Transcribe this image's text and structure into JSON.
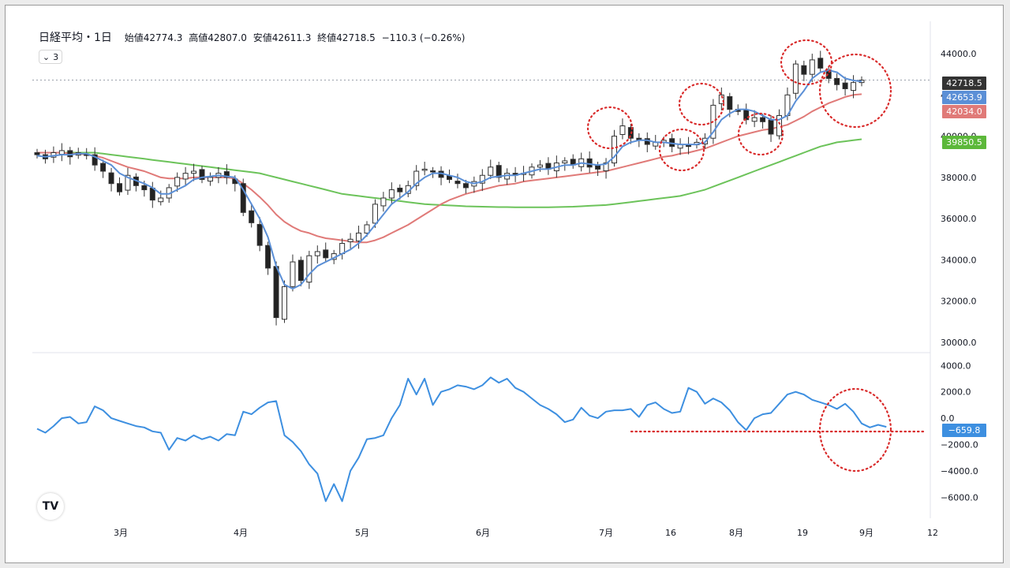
{
  "header": {
    "symbol": "日経平均・1日",
    "open_label": "始値",
    "open": "42774.3",
    "high_label": "高値",
    "high": "42807.0",
    "low_label": "安値",
    "low": "42611.3",
    "close_label": "終値",
    "close": "42718.5",
    "change": "−110.3 (−0.26%)"
  },
  "indicator_button": {
    "label": "3"
  },
  "logo_text": "TV",
  "colors": {
    "ma_short": "#5b8fd6",
    "ma_mid": "#e07a78",
    "ma_long": "#6cc35a",
    "oscillator": "#3d8fe0",
    "up_candle": "#ffffff",
    "down_candle": "#222222",
    "annotation": "#d92b2b"
  },
  "price_badges": [
    {
      "value": "42718.5",
      "color": "#333333"
    },
    {
      "value": "42653.9",
      "color": "#5b8fd6"
    },
    {
      "value": "42034.0",
      "color": "#e07a78"
    },
    {
      "value": "39850.5",
      "color": "#5cb83a"
    }
  ],
  "osc_badge": {
    "value": "−659.8",
    "color": "#3d8fe0"
  },
  "chart_data": {
    "type": "candlestick",
    "main_ylim": [
      29500,
      44500
    ],
    "main_yticks": [
      "44000.0",
      "42000.0",
      "40000.0",
      "38000.0",
      "36000.0",
      "34000.0",
      "32000.0",
      "30000.0"
    ],
    "osc_ylim": [
      -7000,
      4500
    ],
    "osc_yticks": [
      "4000.0",
      "2000.0",
      "0.0",
      "−2000.0",
      "−4000.0",
      "−6000.0"
    ],
    "x_labels": [
      "3月",
      "4月",
      "5月",
      "6月",
      "7月",
      "16",
      "8月",
      "19",
      "9月",
      "12"
    ],
    "close_values": [
      39100,
      38900,
      39200,
      39300,
      39000,
      39200,
      39100,
      38600,
      38300,
      37700,
      37300,
      38100,
      37600,
      37400,
      36900,
      37000,
      37500,
      38000,
      38200,
      38300,
      37900,
      38000,
      38200,
      38000,
      37700,
      36300,
      35800,
      34700,
      33600,
      31200,
      32700,
      33900,
      33000,
      34200,
      34400,
      34100,
      34300,
      34800,
      35000,
      35300,
      35700,
      36700,
      37000,
      37400,
      37300,
      37600,
      38300,
      38400,
      38300,
      38000,
      37900,
      37700,
      37500,
      37800,
      38100,
      38500,
      38000,
      38200,
      38100,
      38200,
      38500,
      38600,
      38400,
      38700,
      38800,
      38600,
      38900,
      38500,
      38400,
      38700,
      40000,
      40500,
      39900,
      39800,
      39600,
      39700,
      39800,
      39500,
      39600,
      39500,
      39700,
      39900,
      41500,
      42000,
      41300,
      41200,
      40800,
      40900,
      40700,
      40100,
      41000,
      42000,
      43500,
      43000,
      43700,
      43300,
      42800,
      42500,
      42300,
      42600,
      42718.5
    ],
    "ma_short_values": [
      39050,
      39000,
      39050,
      39100,
      39100,
      39150,
      39150,
      39000,
      38800,
      38600,
      38200,
      38000,
      37850,
      37700,
      37500,
      37200,
      37200,
      37400,
      37600,
      37900,
      38000,
      38050,
      38100,
      38050,
      38000,
      37400,
      36700,
      36000,
      35100,
      33700,
      32800,
      32600,
      32800,
      33300,
      33700,
      33900,
      34100,
      34300,
      34500,
      34800,
      35200,
      35700,
      36200,
      36700,
      37000,
      37300,
      37700,
      38000,
      38200,
      38200,
      38100,
      38000,
      37800,
      37700,
      37800,
      38000,
      38050,
      38100,
      38100,
      38200,
      38300,
      38400,
      38400,
      38500,
      38600,
      38600,
      38700,
      38650,
      38600,
      38650,
      39000,
      39500,
      39700,
      39800,
      39800,
      39700,
      39700,
      39650,
      39600,
      39600,
      39600,
      39700,
      40200,
      40800,
      41100,
      41300,
      41300,
      41200,
      41000,
      40800,
      40800,
      41000,
      41700,
      42200,
      42800,
      43100,
      43200,
      43100,
      42800,
      42700,
      42653.9
    ],
    "ma_mid_values": [
      39200,
      39200,
      39200,
      39200,
      39150,
      39150,
      39100,
      39050,
      38950,
      38800,
      38650,
      38500,
      38400,
      38300,
      38150,
      38000,
      37950,
      37950,
      37950,
      38000,
      38000,
      38000,
      38000,
      38000,
      37950,
      37700,
      37400,
      37050,
      36650,
      36200,
      35850,
      35600,
      35400,
      35300,
      35150,
      35050,
      35000,
      34950,
      34900,
      34850,
      34850,
      34950,
      35100,
      35300,
      35500,
      35700,
      35950,
      36200,
      36450,
      36700,
      36900,
      37050,
      37200,
      37300,
      37400,
      37500,
      37600,
      37650,
      37700,
      37800,
      37850,
      37900,
      37950,
      38000,
      38050,
      38100,
      38150,
      38200,
      38250,
      38300,
      38400,
      38500,
      38600,
      38700,
      38800,
      38900,
      39000,
      39050,
      39150,
      39200,
      39300,
      39400,
      39550,
      39700,
      39850,
      40000,
      40100,
      40200,
      40300,
      40350,
      40450,
      40550,
      40750,
      40950,
      41200,
      41400,
      41600,
      41750,
      41900,
      42000,
      42034.0
    ],
    "ma_long_values": [
      39200,
      39200,
      39200,
      39200,
      39200,
      39200,
      39200,
      39200,
      39150,
      39100,
      39050,
      39000,
      38950,
      38900,
      38850,
      38800,
      38750,
      38700,
      38650,
      38600,
      38550,
      38500,
      38450,
      38400,
      38350,
      38300,
      38250,
      38200,
      38100,
      38000,
      37900,
      37800,
      37700,
      37600,
      37500,
      37400,
      37300,
      37200,
      37150,
      37100,
      37050,
      37000,
      36950,
      36900,
      36850,
      36800,
      36750,
      36700,
      36680,
      36660,
      36640,
      36620,
      36600,
      36590,
      36580,
      36570,
      36560,
      36560,
      36550,
      36550,
      36550,
      36550,
      36550,
      36560,
      36570,
      36580,
      36600,
      36620,
      36640,
      36660,
      36700,
      36750,
      36800,
      36850,
      36900,
      36950,
      37000,
      37050,
      37100,
      37200,
      37300,
      37400,
      37550,
      37700,
      37850,
      38000,
      38150,
      38300,
      38450,
      38600,
      38750,
      38900,
      39050,
      39200,
      39350,
      39500,
      39600,
      39700,
      39750,
      39800,
      39850.5
    ],
    "oscillator_values": [
      -800,
      -1100,
      -600,
      0,
      100,
      -400,
      -300,
      900,
      600,
      0,
      -200,
      -400,
      -600,
      -700,
      -1000,
      -1100,
      -2400,
      -1500,
      -1700,
      -1300,
      -1600,
      -1400,
      -1700,
      -1200,
      -1300,
      500,
      300,
      800,
      1200,
      1300,
      -1300,
      -1800,
      -2500,
      -3500,
      -4200,
      -6300,
      -5000,
      -6300,
      -4000,
      -3000,
      -1600,
      -1500,
      -1300,
      0,
      1000,
      3000,
      1800,
      3000,
      1000,
      2000,
      2200,
      2500,
      2400,
      2200,
      2500,
      3100,
      2700,
      3000,
      2300,
      2000,
      1500,
      1000,
      700,
      300,
      -300,
      -100,
      800,
      200,
      0,
      500,
      600,
      600,
      700,
      100,
      1000,
      1200,
      700,
      400,
      500,
      2300,
      2000,
      1100,
      1500,
      1200,
      600,
      -300,
      -900,
      0,
      300,
      400,
      1100,
      1800,
      2000,
      1800,
      1400,
      1200,
      1000,
      700,
      1100,
      500,
      -400,
      -700,
      -500,
      -659.8
    ]
  }
}
